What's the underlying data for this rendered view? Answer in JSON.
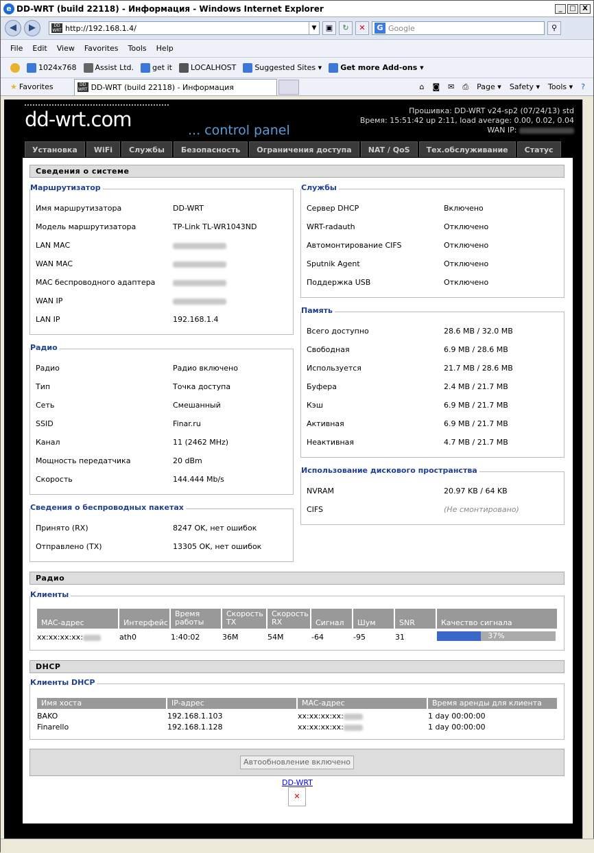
{
  "window": {
    "title": "DD-WRT (build 22118) - Информация - Windows Internet Explorer",
    "url": "http://192.168.1.4/",
    "search_placeholder": "Google",
    "min": "_",
    "max": "□",
    "close": "X"
  },
  "menubar": [
    "File",
    "Edit",
    "View",
    "Favorites",
    "Tools",
    "Help"
  ],
  "favorites_bar": [
    "1024x768",
    "Assist Ltd.",
    "get it",
    "LOCALHOST",
    "Suggested Sites ▾",
    "Get more Add-ons ▾"
  ],
  "favorites_label": "Favorites",
  "tab_title": "DD-WRT (build 22118) - Информация",
  "commands": [
    "Page ▾",
    "Safety ▾",
    "Tools ▾"
  ],
  "header": {
    "firmware": "Прошивка: DD-WRT v24-sp2 (07/24/13) std",
    "time": "Время: 15:51:42 up 2:11, load average: 0.00, 0.02, 0.04",
    "wan_ip_label": "WAN IP:",
    "logo": "dd-wrt.com",
    "control_panel": "... control panel"
  },
  "tabs": [
    "Установка",
    "WiFi",
    "Службы",
    "Безопасность",
    "Ограничения доступа",
    "NAT / QoS",
    "Тех.обслуживание",
    "Статус"
  ],
  "section_system": "Сведения о системе",
  "router": {
    "legend": "Маршрутизатор",
    "rows": [
      [
        "Имя маршрутизатора",
        "DD-WRT"
      ],
      [
        "Модель маршрутизатора",
        "TP-Link TL-WR1043ND"
      ],
      [
        "LAN MAC",
        ""
      ],
      [
        "WAN MAC",
        ""
      ],
      [
        "MAC беспроводного адаптера",
        ""
      ],
      [
        "WAN IP",
        ""
      ],
      [
        "LAN IP",
        "192.168.1.4"
      ]
    ]
  },
  "services": {
    "legend": "Службы",
    "rows": [
      [
        "Сервер DHCP",
        "Включено"
      ],
      [
        "WRT-radauth",
        "Отключено"
      ],
      [
        "Автомонтирование CIFS",
        "Отключено"
      ],
      [
        "Sputnik Agent",
        "Отключено"
      ],
      [
        "Поддержка USB",
        "Отключено"
      ]
    ]
  },
  "memory": {
    "legend": "Память",
    "rows": [
      [
        "Всего доступно",
        "28.6 MB / 32.0 MB"
      ],
      [
        "Свободная",
        "6.9 MB / 28.6 MB"
      ],
      [
        "Используется",
        "21.7 MB / 28.6 MB"
      ],
      [
        "Буфера",
        "2.4 MB / 21.7 MB"
      ],
      [
        "Кэш",
        "6.9 MB / 21.7 MB"
      ],
      [
        "Активная",
        "6.9 MB / 21.7 MB"
      ],
      [
        "Неактивная",
        "4.7 MB / 21.7 MB"
      ]
    ]
  },
  "radio": {
    "legend": "Радио",
    "rows": [
      [
        "Радио",
        "Радио включено"
      ],
      [
        "Тип",
        "Точка доступа"
      ],
      [
        "Сеть",
        "Смешанный"
      ],
      [
        "SSID",
        "Finar.ru"
      ],
      [
        "Канал",
        "11 (2462 MHz)"
      ],
      [
        "Мощность передатчика",
        "20 dBm"
      ],
      [
        "Скорость",
        "144.444 Mb/s"
      ]
    ]
  },
  "disk": {
    "legend": "Использование дискового пространства",
    "rows": [
      [
        "NVRAM",
        "20.97 KB / 64 KB"
      ],
      [
        "CIFS",
        "(Не смонтировано)"
      ]
    ]
  },
  "packets": {
    "legend": "Сведения о беспроводных пакетах",
    "rows": [
      [
        "Принято (RX)",
        "8247 OK, нет ошибок"
      ],
      [
        "Отправлено (TX)",
        "13305 OK, нет ошибок"
      ]
    ]
  },
  "section_radio": "Радио",
  "clients": {
    "legend": "Клиенты",
    "headers": [
      "MAC-адрес",
      "Интерфейс",
      "Время работы",
      "Скорость TX",
      "Скорость RX",
      "Сигнал",
      "Шум",
      "SNR",
      "Качество сигнала"
    ],
    "row": [
      "xx:xx:xx:xx:",
      "ath0",
      "1:40:02",
      "36M",
      "54M",
      "-64",
      "-95",
      "31",
      "37%"
    ],
    "quality": 0.37
  },
  "section_dhcp": "DHCP",
  "dhcp": {
    "legend": "Клиенты DHCP",
    "headers": [
      "Имя хоста",
      "IP-адрес",
      "MAC-адрес",
      "Время аренды для клиента"
    ],
    "rows": [
      [
        "BAKO",
        "192.168.1.103",
        "xx:xx:xx:xx:",
        "1 day 00:00:00"
      ],
      [
        "Finarello",
        "192.168.1.128",
        "xx:xx:xx:xx:",
        "1 day 00:00:00"
      ]
    ]
  },
  "auto_refresh": "Автообновление включено",
  "footer_link": "DD-WRT"
}
